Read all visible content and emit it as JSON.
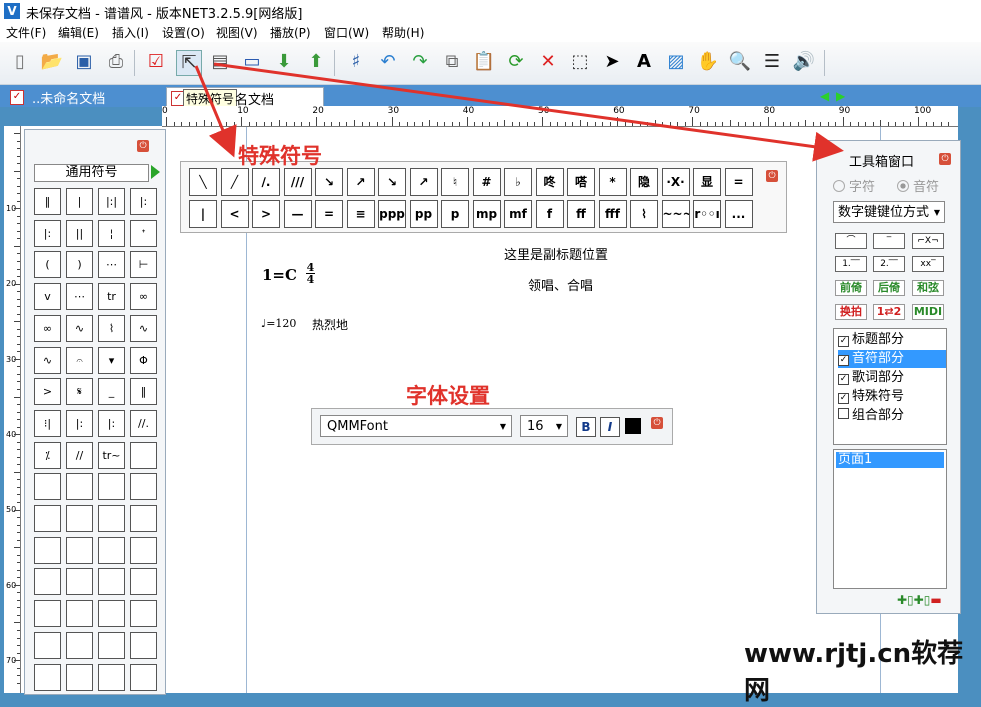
{
  "window": {
    "title": "未保存文档 - 谱谱风 - 版本NET3.2.5.9[网络版]",
    "logo": "V"
  },
  "menu": [
    "文件(F)",
    "编辑(E)",
    "插入(I)",
    "设置(O)",
    "视图(V)",
    "播放(P)",
    "窗口(W)",
    "帮助(H)"
  ],
  "toolbar": {
    "icons": [
      "new-icon",
      "open-icon",
      "save-icon",
      "print-icon",
      "check-icon",
      "select-icon",
      "panel-icon",
      "monitor-icon",
      "download-icon",
      "upload-icon",
      "notation-icon",
      "undo-icon",
      "redo-icon",
      "copy-icon",
      "paste-icon",
      "refresh-icon",
      "delete-icon",
      "marquee-icon",
      "pointer-icon",
      "text-icon",
      "image-icon",
      "hand-icon",
      "zoom-icon",
      "lines-icon",
      "speaker-icon"
    ]
  },
  "tabs": [
    {
      "label": "..未命名文档"
    },
    {
      "label": "名文档",
      "tooltip": "特殊符号"
    }
  ],
  "ruler": {
    "top_labels": [
      "0",
      "10",
      "20",
      "30",
      "40",
      "50",
      "60",
      "70",
      "80",
      "90",
      "100"
    ],
    "left_labels": [
      "10",
      "20",
      "30",
      "40",
      "50",
      "60",
      "70"
    ]
  },
  "palette": {
    "title": "通用符号"
  },
  "annotations": {
    "special": "特殊符号",
    "font": "字体设置"
  },
  "special_symbols": {
    "row1": [
      "╲",
      "╱",
      "∕.",
      "///",
      "↘",
      "↗",
      "↘",
      "↗",
      "♮",
      "#",
      "♭",
      "咚",
      "嗒",
      "*",
      "隐",
      "·X·",
      "显",
      "="
    ],
    "row2": [
      "|",
      "<",
      ">",
      "—",
      "=",
      "≡",
      "ppp",
      "pp",
      "p",
      "mp",
      "mf",
      "f",
      "ff",
      "fff",
      "⌇",
      "~~~",
      "r◦◦ı",
      "..."
    ]
  },
  "score": {
    "subtitle": "这里是副标题位置",
    "roles": "领唱、合唱",
    "key": "1=C",
    "time_num": "4",
    "time_den": "4",
    "tempo": "♩=120",
    "mood": "热烈地"
  },
  "fontbar": {
    "font": "QMMFont",
    "size": "16",
    "bold": "B",
    "italic": "I"
  },
  "toolbox": {
    "title": "工具箱窗口",
    "radio_note": "字符",
    "radio_pitch": "音符",
    "combo": "数字键键位方式",
    "buttons": [
      "前倚",
      "后倚",
      "和弦",
      "换拍",
      "1⇄2",
      "MIDI"
    ],
    "sections": [
      {
        "label": "标题部分",
        "checked": true
      },
      {
        "label": "音符部分",
        "checked": true
      },
      {
        "label": "歌词部分",
        "checked": true
      },
      {
        "label": "特殊符号",
        "checked": true
      },
      {
        "label": "组合部分",
        "checked": false
      }
    ],
    "pages": [
      "页面1"
    ]
  },
  "watermark": "www.rjtj.cn软荐网",
  "colors": {
    "accent": "#e0322b",
    "tab": "#4d8fd0",
    "selection": "#3399ff"
  }
}
